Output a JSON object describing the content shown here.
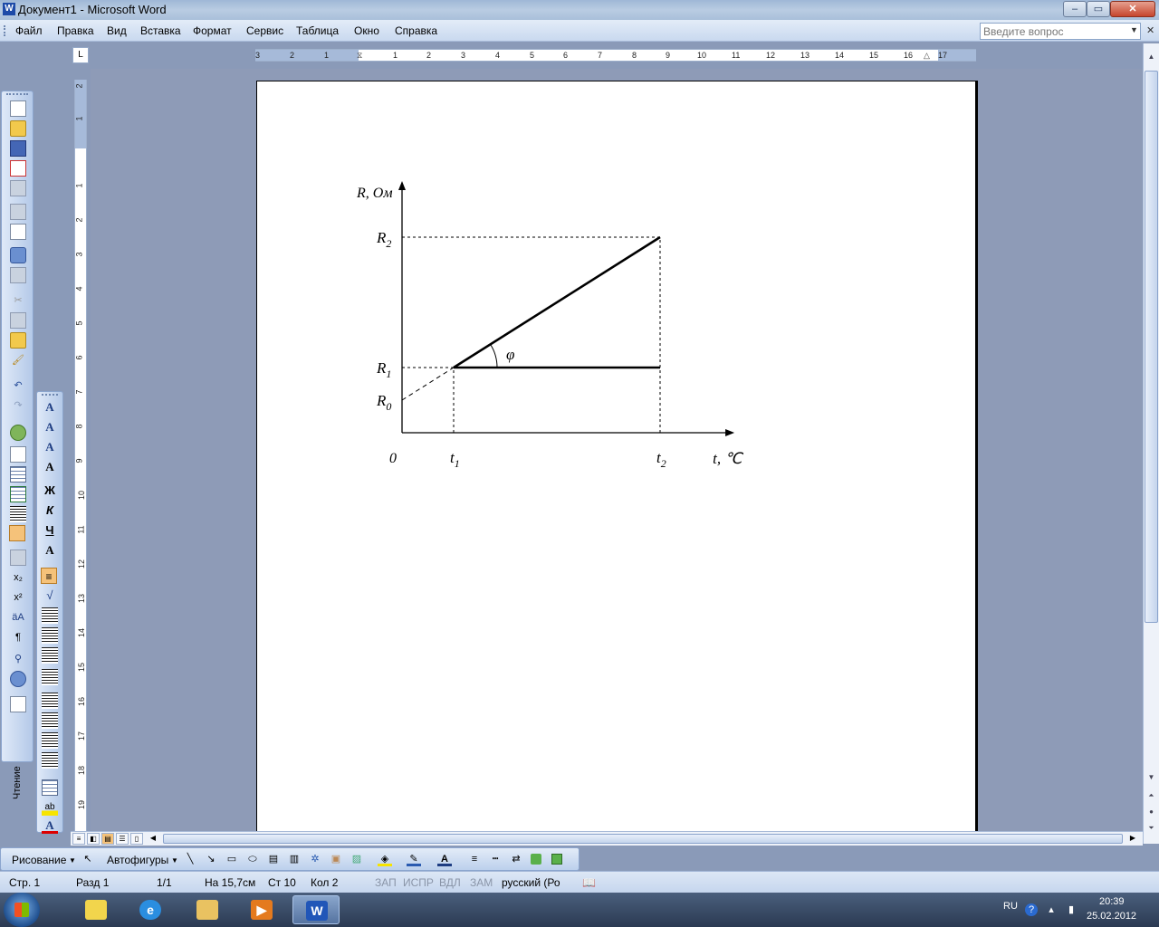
{
  "window": {
    "title": "Документ1 - Microsoft Word",
    "app_icon": "W",
    "min": "‒",
    "max": "▭",
    "close": "✕"
  },
  "menu": {
    "items": [
      "Файл",
      "Правка",
      "Вид",
      "Вставка",
      "Формат",
      "Сервис",
      "Таблица",
      "Окно",
      "Справка"
    ],
    "help_placeholder": "Введите вопрос"
  },
  "toolbar_standard": {
    "reading_label": "Чтение",
    "icons": [
      "new-document-icon",
      "open-folder-icon",
      "save-icon",
      "permission-icon",
      "email-icon",
      "print-icon",
      "print-preview-icon",
      "spelling-icon",
      "research-icon",
      "cut-icon",
      "copy-icon",
      "paste-icon",
      "format-painter-icon",
      "undo-icon",
      "redo-icon",
      "hyperlink-icon",
      "tables-borders-icon",
      "insert-table-icon",
      "insert-excel-icon",
      "columns-icon",
      "drawing-icon",
      "document-map-icon",
      "subscript-icon",
      "superscript-icon",
      "change-case-icon",
      "show-marks-icon",
      "zoom-icon",
      "help-icon",
      "reading-layout-icon"
    ]
  },
  "toolbar_formatting": {
    "glyphs": [
      "A",
      "A",
      "A",
      "A",
      "Ж",
      "К",
      "Ч",
      "A",
      "≡",
      "√",
      "≡",
      "≡",
      "≡",
      "≡",
      "≡",
      "≡",
      "≡",
      "≡",
      "▦",
      "ab",
      "A"
    ]
  },
  "ruler": {
    "horizontal": [
      "3",
      "2",
      "1",
      "1",
      "2",
      "3",
      "4",
      "5",
      "6",
      "7",
      "8",
      "9",
      "10",
      "11",
      "12",
      "13",
      "14",
      "15",
      "16",
      "17"
    ],
    "vertical": [
      "2",
      "1",
      "1",
      "2",
      "3",
      "4",
      "5",
      "6",
      "7",
      "8",
      "9",
      "10",
      "11",
      "12",
      "13",
      "14",
      "15",
      "16",
      "17",
      "18",
      "19"
    ],
    "corner": "L"
  },
  "chart_data": {
    "type": "line",
    "ylabel": "R, Ом",
    "xlabel": "t, ℃",
    "origin_label": "0",
    "x_tick_labels": [
      {
        "main": "t",
        "sub": "1"
      },
      {
        "main": "t",
        "sub": "2"
      }
    ],
    "y_tick_labels": [
      {
        "main": "R",
        "sub": "2"
      },
      {
        "main": "R",
        "sub": "1"
      },
      {
        "main": "R",
        "sub": "0"
      }
    ],
    "angle_label": "φ",
    "series": [
      {
        "style": "solid",
        "x": [
          1.0,
          5.0
        ],
        "y": [
          2.0,
          6.0
        ]
      },
      {
        "style": "solid",
        "x": [
          1.0,
          5.0
        ],
        "y": [
          2.0,
          2.0
        ]
      },
      {
        "style": "dashed",
        "x": [
          0.0,
          1.0
        ],
        "y": [
          1.0,
          2.0
        ]
      }
    ],
    "guides": [
      {
        "style": "dashed",
        "x": [
          0.0,
          1.0
        ],
        "y": [
          2.0,
          2.0
        ]
      },
      {
        "style": "dashed",
        "x": [
          1.0,
          1.0
        ],
        "y": [
          0.0,
          2.0
        ]
      },
      {
        "style": "dashed",
        "x": [
          0.0,
          5.0
        ],
        "y": [
          6.0,
          6.0
        ]
      },
      {
        "style": "dashed",
        "x": [
          5.0,
          5.0
        ],
        "y": [
          0.0,
          6.0
        ]
      }
    ],
    "xlim": [
      0,
      6.3
    ],
    "ylim": [
      0,
      7.5
    ]
  },
  "drawing_toolbar": {
    "drawing_label": "Рисование",
    "autoshapes_label": "Автофигуры",
    "icons": [
      "select-pointer-icon",
      "line-icon",
      "arrow-icon",
      "rectangle-icon",
      "oval-icon",
      "textbox-icon",
      "vertical-textbox-icon",
      "wordart-icon",
      "diagram-icon",
      "clipart-icon",
      "picture-icon",
      "fill-color-icon",
      "line-color-icon",
      "font-color-icon",
      "line-style-icon",
      "dash-style-icon",
      "arrow-style-icon",
      "shadow-icon",
      "3d-icon"
    ]
  },
  "status": {
    "page": "Стр. 1",
    "section": "Разд 1",
    "pages": "1/1",
    "at": "На 15,7см",
    "line": "Ст 10",
    "col": "Кол 2",
    "rec": "ЗАП",
    "trk": "ИСПР",
    "ext": "ВДЛ",
    "ovr": "ЗАМ",
    "lang": "русский (Ро"
  },
  "taskbar": {
    "apps": [
      "explorer-notes-icon",
      "internet-explorer-icon",
      "file-explorer-icon",
      "media-player-icon",
      "word-icon"
    ],
    "lang": "RU",
    "time": "20:39",
    "date": "25.02.2012"
  }
}
